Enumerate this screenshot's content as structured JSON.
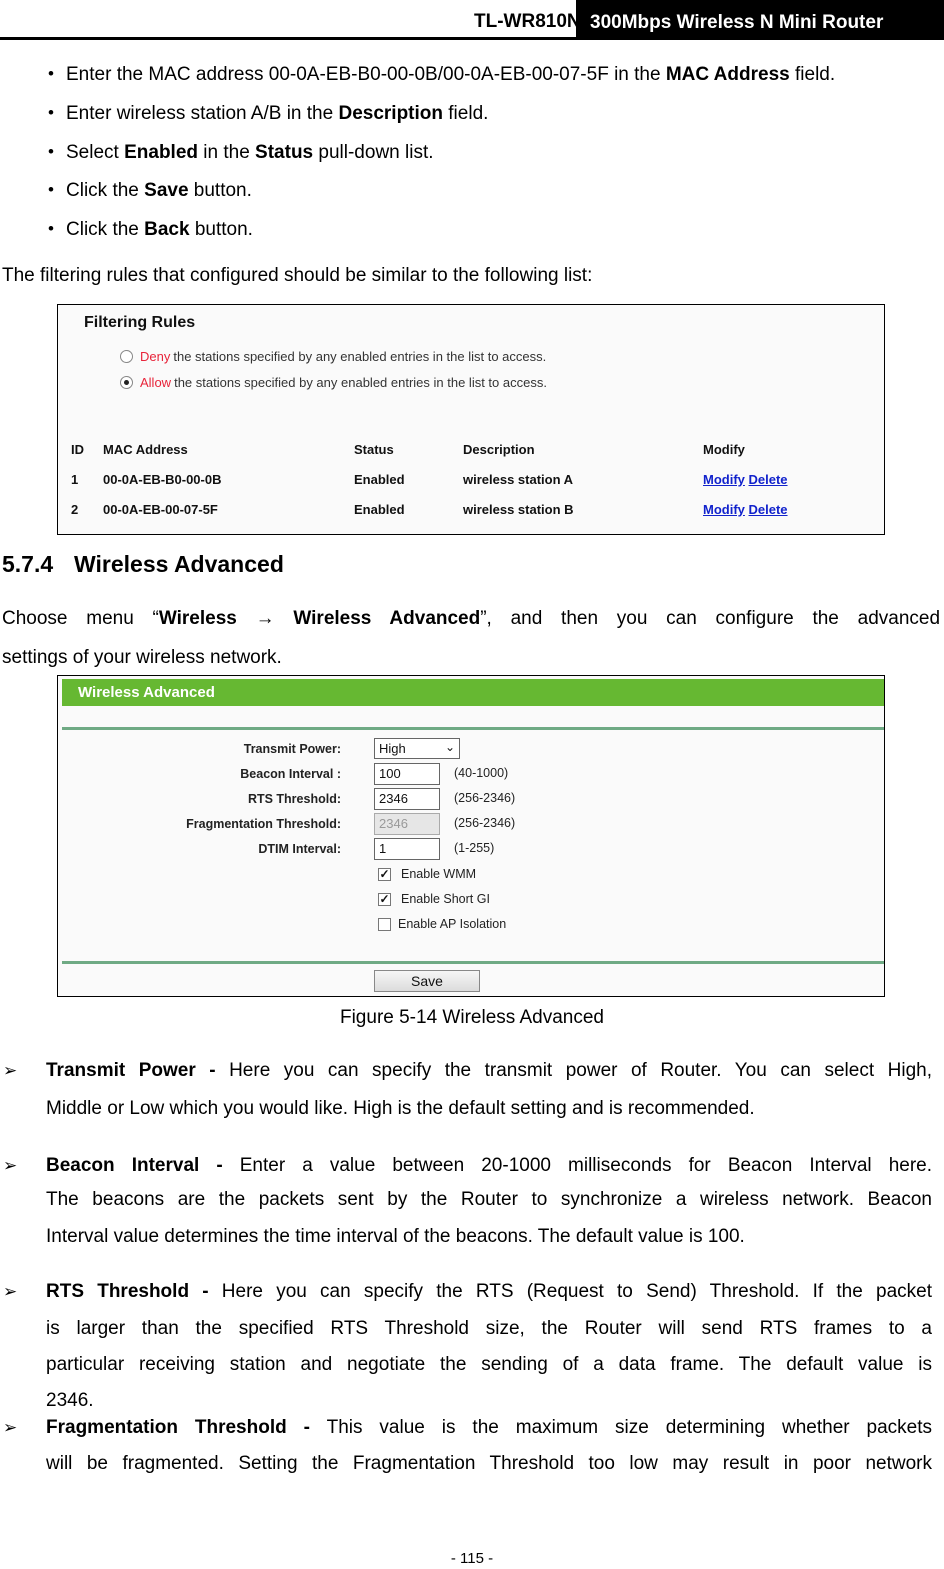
{
  "header": {
    "model": "TL-WR810N",
    "product": "300Mbps Wireless N Mini Router"
  },
  "bullets": [
    {
      "pre": "Enter the MAC address 00-0A-EB-B0-00-0B/00-0A-EB-00-07-5F in the ",
      "bold": "MAC Address",
      "post": " field."
    },
    {
      "pre": "Enter wireless station A/B in the ",
      "bold": "Description",
      "post": " field."
    },
    {
      "pre": "Select ",
      "bold": "Enabled",
      "mid": " in the ",
      "bold2": "Status",
      "post": " pull-down list."
    },
    {
      "pre": "Click the ",
      "bold": "Save",
      "post": " button."
    },
    {
      "pre": "Click the ",
      "bold": "Back",
      "post": " button."
    }
  ],
  "bullet_glyph": "•",
  "intro_filter": "The filtering rules that configured should be similar to the following list:",
  "filtering_rules": {
    "title": "Filtering Rules",
    "options": [
      {
        "keyword": "Deny",
        "text": "the stations specified by any enabled entries in the list to access.",
        "selected": false
      },
      {
        "keyword": "Allow",
        "text": "the stations specified by any enabled entries in the list to access.",
        "selected": true
      }
    ],
    "columns": [
      "ID",
      "MAC Address",
      "Status",
      "Description",
      "Modify"
    ],
    "rows": [
      {
        "id": "1",
        "mac": "00-0A-EB-B0-00-0B",
        "status": "Enabled",
        "description": "wireless station A",
        "modify": "Modify",
        "delete": "Delete"
      },
      {
        "id": "2",
        "mac": "00-0A-EB-00-07-5F",
        "status": "Enabled",
        "description": "wireless station B",
        "modify": "Modify",
        "delete": "Delete"
      }
    ],
    "colors": {
      "keyword": "#e8243a",
      "link": "#1122cc"
    }
  },
  "section": {
    "number": "5.7.4",
    "title": "Wireless Advanced",
    "intro_pre": "Choose menu “",
    "intro_bold1": "Wireless",
    "intro_arrow": "→",
    "intro_bold2": "Wireless Advanced",
    "intro_post": "”, and then you can configure the advanced",
    "intro_line2": "settings of your wireless network."
  },
  "wireless_advanced": {
    "bar_title": "Wireless Advanced",
    "bar_color": "#66b832",
    "fields": [
      {
        "label": "Transmit Power:",
        "type": "select",
        "value": "High"
      },
      {
        "label": "Beacon Interval :",
        "type": "input",
        "value": "100",
        "range": "(40-1000)"
      },
      {
        "label": "RTS Threshold:",
        "type": "input",
        "value": "2346",
        "range": "(256-2346)"
      },
      {
        "label": "Fragmentation Threshold:",
        "type": "input",
        "value": "2346",
        "range": "(256-2346)",
        "disabled": true
      },
      {
        "label": "DTIM Interval:",
        "type": "input",
        "value": "1",
        "range": "(1-255)"
      }
    ],
    "checkboxes": [
      {
        "label": "Enable WMM",
        "checked": true
      },
      {
        "label": "Enable Short GI",
        "checked": true
      },
      {
        "label": "Enable AP Isolation",
        "checked": false
      }
    ],
    "save_label": "Save",
    "chevron_glyph": "⌄",
    "check_glyph": "✓"
  },
  "caption": "Figure 5-14 Wireless Advanced",
  "arrow_glyph": "➢",
  "descriptions": [
    {
      "term": "Transmit Power -",
      "lines": [
        " Here you can specify the transmit power of Router. You can select High,",
        "Middle or Low which you would like. High is the default setting and is recommended."
      ]
    },
    {
      "term": "Beacon Interval -",
      "lines": [
        " Enter a value between 20-1000 milliseconds for Beacon Interval here.",
        "The beacons are the packets sent by the Router to synchronize a wireless network. Beacon",
        "Interval value determines the time interval of the beacons. The default value is 100."
      ]
    },
    {
      "term": "RTS Threshold -",
      "lines": [
        " Here you can specify the RTS (Request to Send) Threshold. If the packet",
        "is larger than the specified RTS Threshold size, the Router will send RTS frames to a",
        "particular receiving station and negotiate the sending of a data frame. The default value is",
        "2346."
      ]
    },
    {
      "term": "Fragmentation Threshold -",
      "lines": [
        " This value is the maximum size determining whether packets",
        "will be fragmented. Setting the Fragmentation Threshold too low may result in poor network"
      ]
    }
  ],
  "footer": "- 115 -"
}
